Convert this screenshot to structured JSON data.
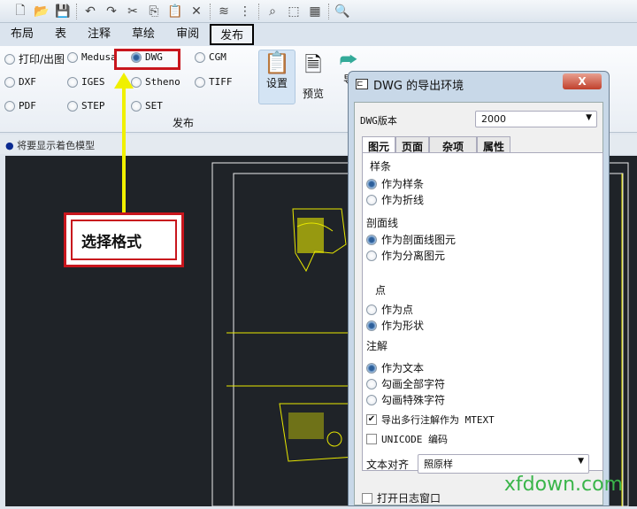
{
  "toolbar": {
    "icons": [
      "new-icon",
      "open-icon",
      "save-icon",
      "undo-icon",
      "redo-icon",
      "cut-icon",
      "copy-icon",
      "paste-icon",
      "delete-icon",
      "layers-icon",
      "tree-icon",
      "find-icon",
      "select-icon",
      "pan-icon",
      "zoom-icon"
    ]
  },
  "tabs": [
    "布局",
    "表",
    "注释",
    "草绘",
    "审阅",
    "发布"
  ],
  "ribbon": {
    "options": [
      "打印/出图",
      "Medusa",
      "DWG",
      "CGM",
      "DXF",
      "IGES",
      "Stheno",
      "TIFF",
      "PDF",
      "STEP",
      "SET"
    ],
    "selected": "DWG",
    "group_label": "发布",
    "buttons": [
      "设置",
      "预览",
      "导"
    ]
  },
  "status": "将要显示着色模型",
  "annotation": {
    "label": "选择格式",
    "accent": "#c8161d",
    "arrow": "#f0f000"
  },
  "dialog": {
    "title": "DWG 的导出环境",
    "close": "X",
    "version_label": "DWG版本",
    "version_value": "2000",
    "tabs": [
      "图元",
      "页面",
      "杂项",
      "属性"
    ],
    "spline": {
      "title": "样条",
      "options": [
        "作为样条",
        "作为折线"
      ]
    },
    "hatch": {
      "title": "剖面线",
      "options": [
        "作为剖面线图元",
        "作为分离图元"
      ]
    },
    "point": {
      "title": "点",
      "options": [
        "作为点",
        "作为形状"
      ]
    },
    "note": {
      "title": "注解",
      "options": [
        "作为文本",
        "勾画全部字符",
        "勾画特殊字符"
      ]
    },
    "mtext": "导出多行注解作为 MTEXT",
    "unicode": "UNICODE 编码",
    "align_label": "文本对齐",
    "align_value": "照原样",
    "log": "打开日志窗口"
  },
  "watermark": "xfdown.com"
}
